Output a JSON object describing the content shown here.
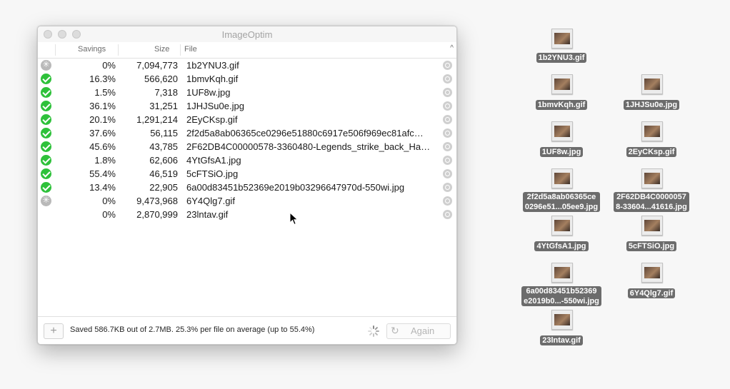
{
  "window": {
    "title": "ImageOptim"
  },
  "columns": {
    "savings": "Savings",
    "size": "Size",
    "file": "File"
  },
  "rows": [
    {
      "status": "busy",
      "savings": "0%",
      "size": "7,094,773",
      "file": "1b2YNU3.gif"
    },
    {
      "status": "ok",
      "savings": "16.3%",
      "size": "566,620",
      "file": "1bmvKqh.gif"
    },
    {
      "status": "ok",
      "savings": "1.5%",
      "size": "7,318",
      "file": "1UF8w.jpg"
    },
    {
      "status": "ok",
      "savings": "36.1%",
      "size": "31,251",
      "file": "1JHJSu0e.jpg"
    },
    {
      "status": "ok",
      "savings": "20.1%",
      "size": "1,291,214",
      "file": "2EyCKsp.gif"
    },
    {
      "status": "ok",
      "savings": "37.6%",
      "size": "56,115",
      "file": "2f2d5a8ab06365ce0296e51880c6917e506f969ec81afc…"
    },
    {
      "status": "ok",
      "savings": "45.6%",
      "size": "43,785",
      "file": "2F62DB4C00000578-3360480-Legends_strike_back_Ha…"
    },
    {
      "status": "ok",
      "savings": "1.8%",
      "size": "62,606",
      "file": "4YtGfsA1.jpg"
    },
    {
      "status": "ok",
      "savings": "55.4%",
      "size": "46,519",
      "file": "5cFTSiO.jpg"
    },
    {
      "status": "ok",
      "savings": "13.4%",
      "size": "22,905",
      "file": "6a00d83451b52369e2019b03296647970d-550wi.jpg"
    },
    {
      "status": "busy",
      "savings": "0%",
      "size": "9,473,968",
      "file": "6Y4Qlg7.gif"
    },
    {
      "status": "none",
      "savings": "0%",
      "size": "2,870,999",
      "file": "23lntav.gif"
    }
  ],
  "footer": {
    "add_label": "+",
    "summary": "Saved 586.7KB out of 2.7MB. 25.3% per file on average (up to 55.4%)",
    "again_label": "Again"
  },
  "desktop_icons": [
    {
      "label": "1b2YNU3.gif"
    },
    {
      "label": "1bmvKqh.gif"
    },
    {
      "label": "1JHJSu0e.jpg"
    },
    {
      "label": "1UF8w.jpg"
    },
    {
      "label": "2EyCKsp.gif"
    },
    {
      "label": "2f2d5a8ab06365ce\n0296e51...05ee9.jpg"
    },
    {
      "label": "2F62DB4C0000057\n8-33604...41616.jpg"
    },
    {
      "label": "4YtGfsA1.jpg"
    },
    {
      "label": "5cFTSiO.jpg"
    },
    {
      "label": "6a00d83451b52369\ne2019b0...-550wi.jpg"
    },
    {
      "label": "6Y4Qlg7.gif"
    },
    {
      "label": "23lntav.gif"
    }
  ],
  "colors": {
    "success": "#2ec13a",
    "pending": "#b9b9b9",
    "label_bg": "#6c6c6c"
  }
}
